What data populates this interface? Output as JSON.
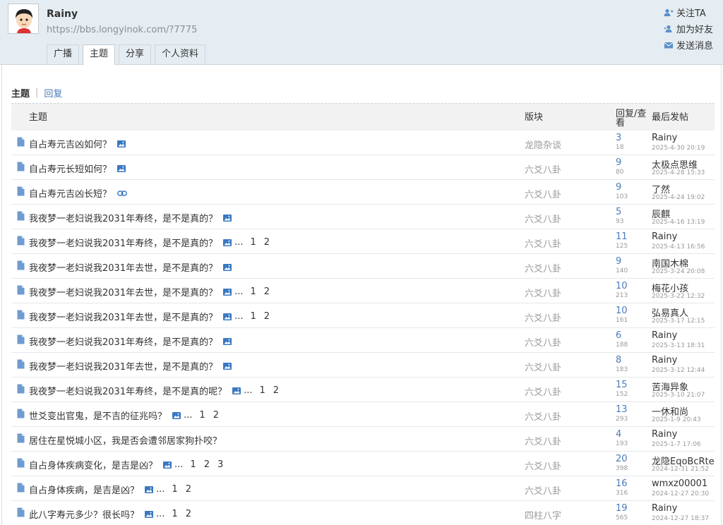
{
  "profile": {
    "name": "Rainy",
    "url": "https://bbs.longyinok.com/?7775",
    "tabs": [
      "广播",
      "主题",
      "分享",
      "个人资料"
    ],
    "active_tab": 1
  },
  "actions": [
    {
      "label": "关注TA",
      "icon": "follow-icon"
    },
    {
      "label": "加为好友",
      "icon": "add-friend-icon"
    },
    {
      "label": "发送消息",
      "icon": "envelope-icon"
    }
  ],
  "subnav": {
    "current": "主题",
    "link": "回复"
  },
  "columns": {
    "topic": "主题",
    "forum": "版块",
    "reply_view": "回复/查看",
    "last_post": "最后发帖"
  },
  "threads": [
    {
      "title": "自占寿元吉凶如何？",
      "icon": "image",
      "pages": [],
      "forum": "龙隐杂谈",
      "replies": "3",
      "views": "18",
      "last_user": "Rainy",
      "last_time": "2025-4-30 20:19"
    },
    {
      "title": "自占寿元长短如何？",
      "icon": "image",
      "pages": [],
      "forum": "六爻八卦",
      "replies": "9",
      "views": "80",
      "last_user": "太极点思维",
      "last_time": "2025-4-28 15:33"
    },
    {
      "title": "自占寿元吉凶长短？",
      "icon": "link",
      "pages": [],
      "forum": "六爻八卦",
      "replies": "9",
      "views": "103",
      "last_user": "了然",
      "last_time": "2025-4-24 19:02"
    },
    {
      "title": "我夜梦一老妇说我2031年寿终，是不是真的？",
      "icon": "image",
      "pages": [],
      "forum": "六爻八卦",
      "replies": "5",
      "views": "93",
      "last_user": "辰麒",
      "last_time": "2025-4-16 13:19"
    },
    {
      "title": "我夜梦一老妇说我2031年寿终，是不是真的？",
      "icon": "image",
      "pages": [
        "1",
        "2"
      ],
      "forum": "六爻八卦",
      "replies": "11",
      "views": "125",
      "last_user": "Rainy",
      "last_time": "2025-4-13 16:56"
    },
    {
      "title": "我夜梦一老妇说我2031年去世，是不是真的？",
      "icon": "image",
      "pages": [],
      "forum": "六爻八卦",
      "replies": "9",
      "views": "140",
      "last_user": "南国木棉",
      "last_time": "2025-3-24 20:08"
    },
    {
      "title": "我夜梦一老妇说我2031年去世，是不是真的？",
      "icon": "image",
      "pages": [
        "1",
        "2"
      ],
      "forum": "六爻八卦",
      "replies": "10",
      "views": "213",
      "last_user": "梅花小孩",
      "last_time": "2025-3-22 12:32"
    },
    {
      "title": "我夜梦一老妇说我2031年去世，是不是真的？",
      "icon": "image",
      "pages": [
        "1",
        "2"
      ],
      "forum": "六爻八卦",
      "replies": "10",
      "views": "161",
      "last_user": "弘易真人",
      "last_time": "2025-3-17 12:15"
    },
    {
      "title": "我夜梦一老妇说我2031年寿终，是不是真的？",
      "icon": "image",
      "pages": [],
      "forum": "六爻八卦",
      "replies": "6",
      "views": "188",
      "last_user": "Rainy",
      "last_time": "2025-3-13 18:31"
    },
    {
      "title": "我夜梦一老妇说我2031年去世，是不是真的？",
      "icon": "image",
      "pages": [],
      "forum": "六爻八卦",
      "replies": "8",
      "views": "183",
      "last_user": "Rainy",
      "last_time": "2025-3-12 12:44"
    },
    {
      "title": "我夜梦一老妇说我2031年寿终，是不是真的呢？",
      "icon": "image",
      "pages": [
        "1",
        "2"
      ],
      "forum": "六爻八卦",
      "replies": "15",
      "views": "152",
      "last_user": "苦海异象",
      "last_time": "2025-3-10 21:07"
    },
    {
      "title": "世爻变出官鬼，是不吉的征兆吗？",
      "icon": "image",
      "pages": [
        "1",
        "2"
      ],
      "forum": "六爻八卦",
      "replies": "13",
      "views": "293",
      "last_user": "一休和尚",
      "last_time": "2025-1-9 20:43"
    },
    {
      "title": "居住在星悦城小区，我是否会遭邻居家狗扑咬？",
      "icon": "",
      "pages": [],
      "forum": "六爻八卦",
      "replies": "4",
      "views": "193",
      "last_user": "Rainy",
      "last_time": "2025-1-7 17:06"
    },
    {
      "title": "自占身体疾病变化，是吉是凶？",
      "icon": "image",
      "pages": [
        "1",
        "2",
        "3"
      ],
      "forum": "六爻八卦",
      "replies": "20",
      "views": "398",
      "last_user": "龙隐EqoBcRte",
      "last_time": "2024-12-31 21:52"
    },
    {
      "title": "自占身体疾病，是吉是凶？",
      "icon": "image",
      "pages": [
        "1",
        "2"
      ],
      "forum": "六爻八卦",
      "replies": "16",
      "views": "316",
      "last_user": "wmxz00001",
      "last_time": "2024-12-27 20:30"
    },
    {
      "title": "此八字寿元多少？很长吗？",
      "icon": "image",
      "pages": [
        "1",
        "2"
      ],
      "forum": "四柱八字",
      "replies": "19",
      "views": "565",
      "last_user": "Rainy",
      "last_time": "2024-12-27 18:37"
    }
  ],
  "colors": {
    "header_bg": "#e5edf2",
    "link_blue": "#4a7cb8",
    "icon_blue": "#3a78c2",
    "muted": "#999999"
  }
}
